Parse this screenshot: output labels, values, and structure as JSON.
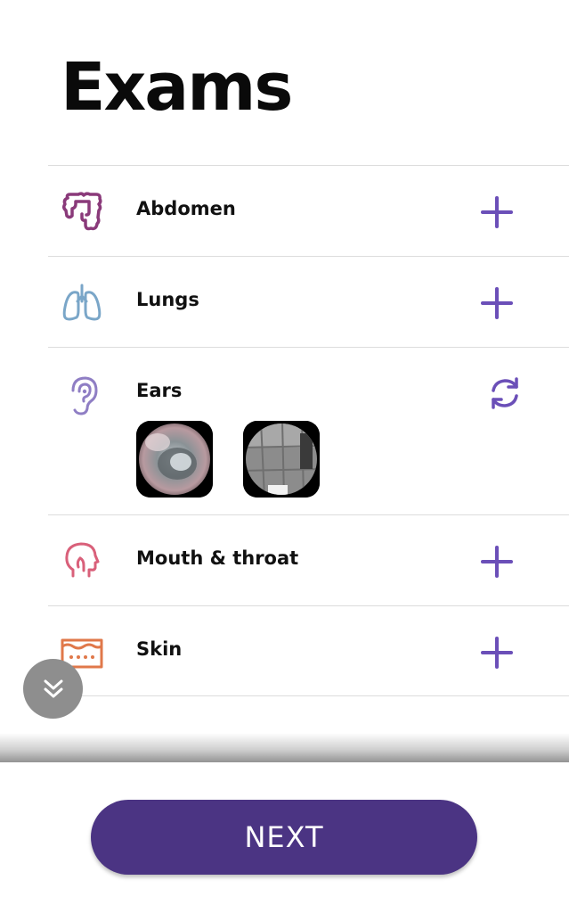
{
  "page": {
    "title": "Exams"
  },
  "exams": [
    {
      "label": "Abdomen",
      "icon": "intestine-icon",
      "action": "add",
      "icon_color": "#8a3a7a"
    },
    {
      "label": "Lungs",
      "icon": "lungs-icon",
      "action": "add",
      "icon_color": "#7aa6c8"
    },
    {
      "label": "Ears",
      "icon": "ear-icon",
      "action": "retake",
      "icon_color": "#8f7ec4",
      "thumbnails": [
        "ear-exam-photo-1",
        "ear-exam-photo-2"
      ]
    },
    {
      "label": "Mouth & throat",
      "icon": "head-profile-icon",
      "action": "add",
      "icon_color": "#d9607a"
    },
    {
      "label": "Skin",
      "icon": "skin-layers-icon",
      "action": "add",
      "icon_color": "#e0784a"
    }
  ],
  "footer": {
    "next_label": "NEXT"
  },
  "colors": {
    "accent": "#6b4fb8",
    "primary_button": "#4b3483",
    "fab": "#8e8e8e",
    "divider": "#dcdcdc"
  },
  "scroll_fab": {
    "icon": "double-chevron-down-icon"
  }
}
